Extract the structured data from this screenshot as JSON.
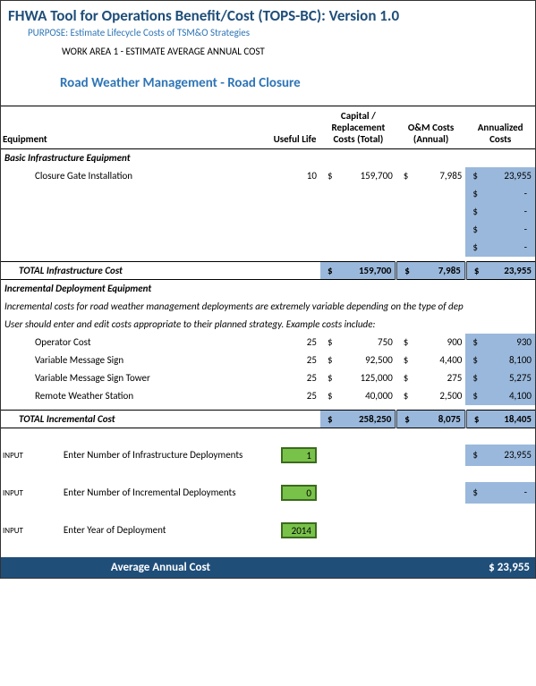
{
  "header": {
    "title": "FHWA Tool for Operations Benefit/Cost (TOPS-BC):  Version 1.0",
    "purpose": "PURPOSE:  Estimate Lifecycle Costs of TSM&O Strategies",
    "workarea": "WORK AREA 1 - ESTIMATE AVERAGE ANNUAL COST",
    "strategy": "Road Weather Management - Road Closure"
  },
  "columns": {
    "equipment": "Equipment",
    "life": "Useful Life",
    "capital": "Capital / Replacement Costs (Total)",
    "om": "O&M Costs (Annual)",
    "ann": "Annualized Costs"
  },
  "sections": {
    "infra_label": "Basic Infrastructure Equipment",
    "incr_label": "Incremental Deployment Equipment",
    "infra_rows": [
      {
        "name": "Closure Gate Installation",
        "life": "10",
        "cap": "159,700",
        "om": "7,985",
        "ann": "23,955"
      }
    ],
    "blank_dash": "-",
    "infra_total": {
      "label": "TOTAL Infrastructure Cost",
      "cap": "159,700",
      "om": "7,985",
      "ann": "23,955"
    },
    "incr_note1": "Incremental costs for road weather management deployments are extremely variable depending on the type of dep",
    "incr_note2": "User should enter and edit costs appropriate to their planned strategy.  Example costs include:",
    "incr_rows": [
      {
        "name": "Operator Cost",
        "life": "25",
        "cap": "750",
        "om": "900",
        "ann": "930"
      },
      {
        "name": "Variable Message Sign",
        "life": "25",
        "cap": "92,500",
        "om": "4,400",
        "ann": "8,100"
      },
      {
        "name": "Variable Message Sign Tower",
        "life": "25",
        "cap": "125,000",
        "om": "275",
        "ann": "5,275"
      },
      {
        "name": "Remote Weather Station",
        "life": "25",
        "cap": "40,000",
        "om": "2,500",
        "ann": "4,100"
      }
    ],
    "incr_total": {
      "label": "TOTAL Incremental Cost",
      "cap": "258,250",
      "om": "8,075",
      "ann": "18,405"
    }
  },
  "inputs": {
    "tag": "INPUT",
    "infra_dep": {
      "label": "Enter Number of Infrastructure Deployments",
      "value": "1",
      "ann": "23,955"
    },
    "incr_dep": {
      "label": "Enter Number of Incremental Deployments",
      "value": "0",
      "ann": "-"
    },
    "year": {
      "label": "Enter Year of Deployment",
      "value": "2014"
    }
  },
  "footer": {
    "label": "Average Annual Cost",
    "value": "$  23,955"
  },
  "sym": {
    "dollar": "$"
  }
}
